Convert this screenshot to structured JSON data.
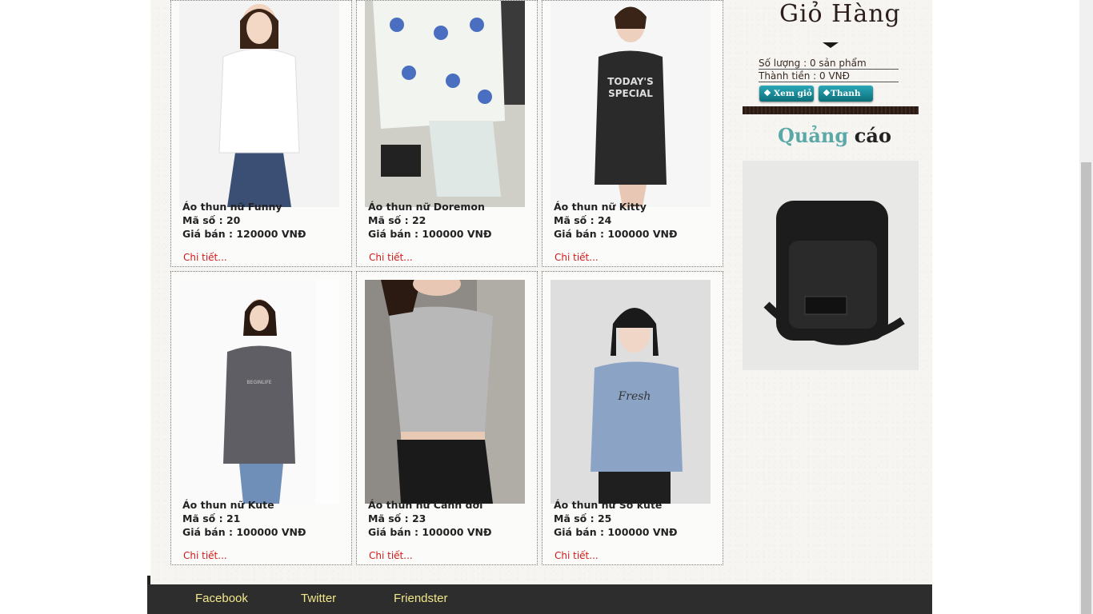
{
  "cart": {
    "title": "Giỏ Hàng",
    "quantity": "Số lượng : 0 sản phẩm",
    "total": "Thành tiền : 0 VNĐ",
    "view_button": "Xem giỏ",
    "checkout_button": "Thanh toán"
  },
  "ad": {
    "title_part1": "Quảng",
    "title_part2": "cáo"
  },
  "products": [
    {
      "name": "Áo thun nữ Funny",
      "code": "Mã số : 20",
      "price": "Giá bán : 120000 VNĐ",
      "detail": "Chi tiết..."
    },
    {
      "name": "Áo thun nữ Doremon",
      "code": "Mã số : 22",
      "price": "Giá bán : 100000 VNĐ",
      "detail": "Chi tiết..."
    },
    {
      "name": "Áo thun nữ Kitty",
      "code": "Mã số : 24",
      "price": "Giá bán : 100000 VNĐ",
      "detail": "Chi tiết..."
    },
    {
      "name": "Áo thun nữ Kute",
      "code": "Mã số : 21",
      "price": "Giá bán : 100000 VNĐ",
      "detail": "Chi tiết..."
    },
    {
      "name": "Áo thun nữ Cánh dơi",
      "code": "Mã số : 23",
      "price": "Giá bán : 100000 VNĐ",
      "detail": "Chi tiết..."
    },
    {
      "name": "Áo thun nữ So kute",
      "code": "Mã số : 25",
      "price": "Giá bán : 100000 VNĐ",
      "detail": "Chi tiết..."
    }
  ],
  "footer": {
    "links": [
      "Facebook",
      "Twitter",
      "Friendster"
    ]
  },
  "colors": {
    "accent": "#5aa9a7",
    "link": "#d21a1a",
    "footer_bg": "#2d2d2d",
    "footer_link": "#f2e88a",
    "button": "#0d6f7a"
  }
}
